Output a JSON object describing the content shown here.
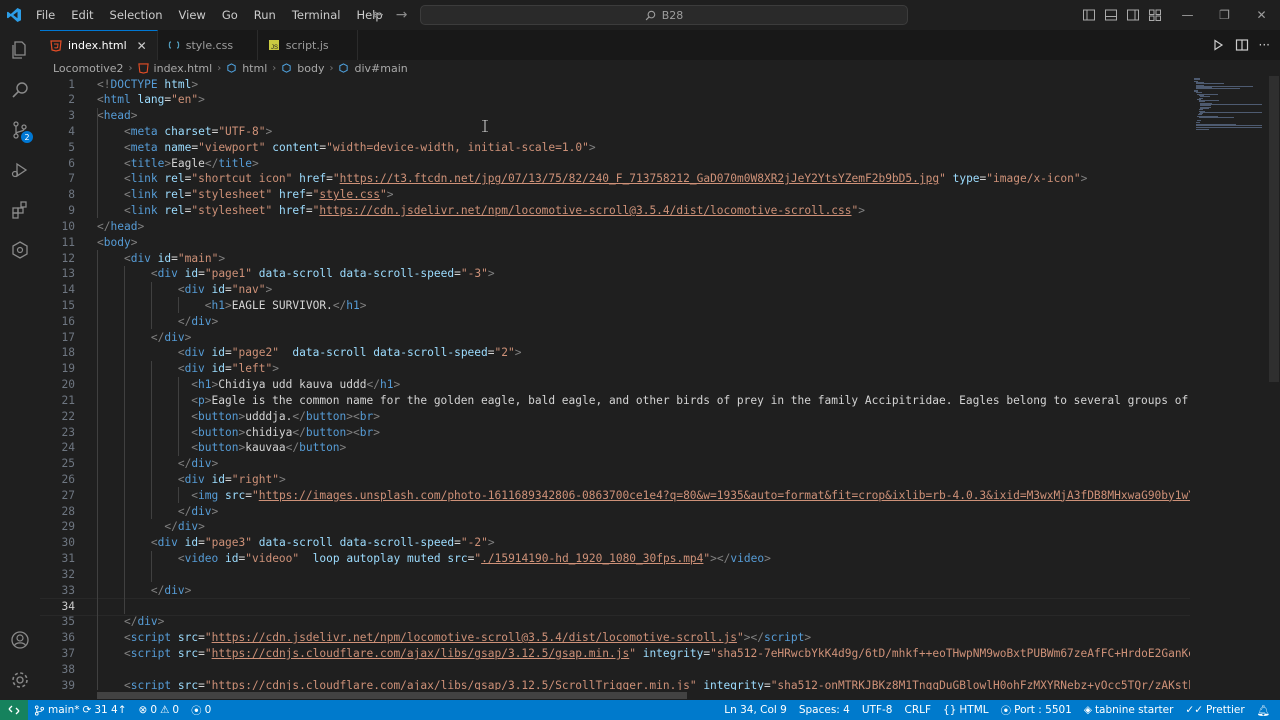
{
  "menu": [
    "File",
    "Edit",
    "Selection",
    "View",
    "Go",
    "Run",
    "Terminal",
    "Help"
  ],
  "search": {
    "text": "B28"
  },
  "tabs": [
    {
      "label": "index.html",
      "active": true
    },
    {
      "label": "style.css",
      "active": false
    },
    {
      "label": "script.js",
      "active": false
    }
  ],
  "breadcrumb": [
    "Locomotive2",
    "index.html",
    "html",
    "body",
    "div#main"
  ],
  "activity": {
    "scm_badge": "2"
  },
  "editor": {
    "line_numbers": [
      "1",
      "2",
      "3",
      "4",
      "5",
      "6",
      "7",
      "8",
      "9",
      "10",
      "11",
      "12",
      "13",
      "14",
      "15",
      "16",
      "17",
      "18",
      "19",
      "20",
      "21",
      "22",
      "23",
      "24",
      "25",
      "26",
      "27",
      "28",
      "29",
      "30",
      "31",
      "32",
      "33",
      "34",
      "35",
      "36",
      "37",
      "38",
      "39",
      "40"
    ],
    "current_line": "34"
  },
  "status": {
    "branch": "main*",
    "sync": "31 4↑",
    "errors": "0",
    "warnings": "0",
    "ports_count": "0",
    "position": "Ln 34, Col 9",
    "spaces": "Spaces: 4",
    "encoding": "UTF-8",
    "eol": "CRLF",
    "language": "HTML",
    "port": "Port : 5501",
    "tabnine": "tabnine starter",
    "prettier": "Prettier"
  },
  "colors": {
    "statusbar": "#007acc",
    "accent": "#0078d4",
    "tag": "#569cd6",
    "attr": "#9cdcfe",
    "string": "#ce9178"
  }
}
